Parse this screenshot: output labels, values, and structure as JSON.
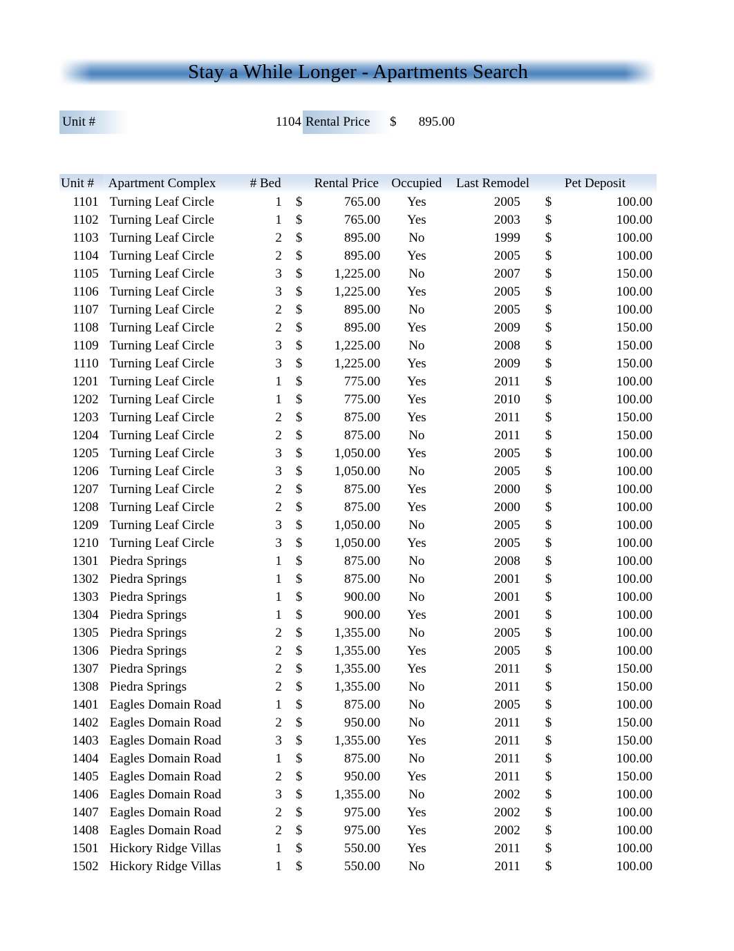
{
  "document": {
    "title": "Stay a While Longer - Apartments Search"
  },
  "lookup": {
    "unit_label": "Unit #",
    "unit_value": "1104",
    "price_label": "Rental Price",
    "price_symbol": "$",
    "price_value": "895.00"
  },
  "table": {
    "headers": {
      "unit": "Unit #",
      "complex": "Apartment Complex",
      "bed": "# Bed",
      "price": "Rental Price",
      "occupied": "Occupied",
      "remodel": "Last Remodel",
      "deposit": "Pet Deposit"
    },
    "currency_symbol": "$",
    "rows": [
      {
        "unit": "1101",
        "complex": "Turning Leaf Circle",
        "bed": "1",
        "sym": "$",
        "price": "765.00",
        "occupied": "Yes",
        "remodel": "2005",
        "dsym": "$",
        "deposit": "100.00"
      },
      {
        "unit": "1102",
        "complex": "Turning Leaf Circle",
        "bed": "1",
        "sym": "$",
        "price": "765.00",
        "occupied": "Yes",
        "remodel": "2003",
        "dsym": "$",
        "deposit": "100.00"
      },
      {
        "unit": "1103",
        "complex": "Turning Leaf Circle",
        "bed": "2",
        "sym": "$",
        "price": "895.00",
        "occupied": "No",
        "remodel": "1999",
        "dsym": "$",
        "deposit": "100.00"
      },
      {
        "unit": "1104",
        "complex": "Turning Leaf Circle",
        "bed": "2",
        "sym": "$",
        "price": "895.00",
        "occupied": "Yes",
        "remodel": "2005",
        "dsym": "$",
        "deposit": "100.00"
      },
      {
        "unit": "1105",
        "complex": "Turning Leaf Circle",
        "bed": "3",
        "sym": "$",
        "price": "1,225.00",
        "occupied": "No",
        "remodel": "2007",
        "dsym": "$",
        "deposit": "150.00"
      },
      {
        "unit": "1106",
        "complex": "Turning Leaf Circle",
        "bed": "3",
        "sym": "$",
        "price": "1,225.00",
        "occupied": "Yes",
        "remodel": "2005",
        "dsym": "$",
        "deposit": "100.00"
      },
      {
        "unit": "1107",
        "complex": "Turning Leaf Circle",
        "bed": "2",
        "sym": "$",
        "price": "895.00",
        "occupied": "No",
        "remodel": "2005",
        "dsym": "$",
        "deposit": "100.00"
      },
      {
        "unit": "1108",
        "complex": "Turning Leaf Circle",
        "bed": "2",
        "sym": "$",
        "price": "895.00",
        "occupied": "Yes",
        "remodel": "2009",
        "dsym": "$",
        "deposit": "150.00"
      },
      {
        "unit": "1109",
        "complex": "Turning Leaf Circle",
        "bed": "3",
        "sym": "$",
        "price": "1,225.00",
        "occupied": "No",
        "remodel": "2008",
        "dsym": "$",
        "deposit": "150.00"
      },
      {
        "unit": "1110",
        "complex": "Turning Leaf Circle",
        "bed": "3",
        "sym": "$",
        "price": "1,225.00",
        "occupied": "Yes",
        "remodel": "2009",
        "dsym": "$",
        "deposit": "150.00"
      },
      {
        "unit": "1201",
        "complex": "Turning Leaf Circle",
        "bed": "1",
        "sym": "$",
        "price": "775.00",
        "occupied": "Yes",
        "remodel": "2011",
        "dsym": "$",
        "deposit": "100.00"
      },
      {
        "unit": "1202",
        "complex": "Turning Leaf Circle",
        "bed": "1",
        "sym": "$",
        "price": "775.00",
        "occupied": "Yes",
        "remodel": "2010",
        "dsym": "$",
        "deposit": "100.00"
      },
      {
        "unit": "1203",
        "complex": "Turning Leaf Circle",
        "bed": "2",
        "sym": "$",
        "price": "875.00",
        "occupied": "Yes",
        "remodel": "2011",
        "dsym": "$",
        "deposit": "150.00"
      },
      {
        "unit": "1204",
        "complex": "Turning Leaf Circle",
        "bed": "2",
        "sym": "$",
        "price": "875.00",
        "occupied": "No",
        "remodel": "2011",
        "dsym": "$",
        "deposit": "150.00"
      },
      {
        "unit": "1205",
        "complex": "Turning Leaf Circle",
        "bed": "3",
        "sym": "$",
        "price": "1,050.00",
        "occupied": "Yes",
        "remodel": "2005",
        "dsym": "$",
        "deposit": "100.00"
      },
      {
        "unit": "1206",
        "complex": "Turning Leaf Circle",
        "bed": "3",
        "sym": "$",
        "price": "1,050.00",
        "occupied": "No",
        "remodel": "2005",
        "dsym": "$",
        "deposit": "100.00"
      },
      {
        "unit": "1207",
        "complex": "Turning Leaf Circle",
        "bed": "2",
        "sym": "$",
        "price": "875.00",
        "occupied": "Yes",
        "remodel": "2000",
        "dsym": "$",
        "deposit": "100.00"
      },
      {
        "unit": "1208",
        "complex": "Turning Leaf Circle",
        "bed": "2",
        "sym": "$",
        "price": "875.00",
        "occupied": "Yes",
        "remodel": "2000",
        "dsym": "$",
        "deposit": "100.00"
      },
      {
        "unit": "1209",
        "complex": "Turning Leaf Circle",
        "bed": "3",
        "sym": "$",
        "price": "1,050.00",
        "occupied": "No",
        "remodel": "2005",
        "dsym": "$",
        "deposit": "100.00"
      },
      {
        "unit": "1210",
        "complex": "Turning Leaf Circle",
        "bed": "3",
        "sym": "$",
        "price": "1,050.00",
        "occupied": "Yes",
        "remodel": "2005",
        "dsym": "$",
        "deposit": "100.00"
      },
      {
        "unit": "1301",
        "complex": "Piedra Springs",
        "bed": "1",
        "sym": "$",
        "price": "875.00",
        "occupied": "No",
        "remodel": "2008",
        "dsym": "$",
        "deposit": "100.00"
      },
      {
        "unit": "1302",
        "complex": "Piedra Springs",
        "bed": "1",
        "sym": "$",
        "price": "875.00",
        "occupied": "No",
        "remodel": "2001",
        "dsym": "$",
        "deposit": "100.00"
      },
      {
        "unit": "1303",
        "complex": "Piedra Springs",
        "bed": "1",
        "sym": "$",
        "price": "900.00",
        "occupied": "No",
        "remodel": "2001",
        "dsym": "$",
        "deposit": "100.00"
      },
      {
        "unit": "1304",
        "complex": "Piedra Springs",
        "bed": "1",
        "sym": "$",
        "price": "900.00",
        "occupied": "Yes",
        "remodel": "2001",
        "dsym": "$",
        "deposit": "100.00"
      },
      {
        "unit": "1305",
        "complex": "Piedra Springs",
        "bed": "2",
        "sym": "$",
        "price": "1,355.00",
        "occupied": "No",
        "remodel": "2005",
        "dsym": "$",
        "deposit": "100.00"
      },
      {
        "unit": "1306",
        "complex": "Piedra Springs",
        "bed": "2",
        "sym": "$",
        "price": "1,355.00",
        "occupied": "Yes",
        "remodel": "2005",
        "dsym": "$",
        "deposit": "100.00"
      },
      {
        "unit": "1307",
        "complex": "Piedra Springs",
        "bed": "2",
        "sym": "$",
        "price": "1,355.00",
        "occupied": "Yes",
        "remodel": "2011",
        "dsym": "$",
        "deposit": "150.00"
      },
      {
        "unit": "1308",
        "complex": "Piedra Springs",
        "bed": "2",
        "sym": "$",
        "price": "1,355.00",
        "occupied": "No",
        "remodel": "2011",
        "dsym": "$",
        "deposit": "150.00"
      },
      {
        "unit": "1401",
        "complex": "Eagles Domain Road",
        "bed": "1",
        "sym": "$",
        "price": "875.00",
        "occupied": "No",
        "remodel": "2005",
        "dsym": "$",
        "deposit": "100.00"
      },
      {
        "unit": "1402",
        "complex": "Eagles Domain Road",
        "bed": "2",
        "sym": "$",
        "price": "950.00",
        "occupied": "No",
        "remodel": "2011",
        "dsym": "$",
        "deposit": "150.00"
      },
      {
        "unit": "1403",
        "complex": "Eagles Domain Road",
        "bed": "3",
        "sym": "$",
        "price": "1,355.00",
        "occupied": "Yes",
        "remodel": "2011",
        "dsym": "$",
        "deposit": "150.00"
      },
      {
        "unit": "1404",
        "complex": "Eagles Domain Road",
        "bed": "1",
        "sym": "$",
        "price": "875.00",
        "occupied": "No",
        "remodel": "2011",
        "dsym": "$",
        "deposit": "100.00"
      },
      {
        "unit": "1405",
        "complex": "Eagles Domain Road",
        "bed": "2",
        "sym": "$",
        "price": "950.00",
        "occupied": "Yes",
        "remodel": "2011",
        "dsym": "$",
        "deposit": "150.00"
      },
      {
        "unit": "1406",
        "complex": "Eagles Domain Road",
        "bed": "3",
        "sym": "$",
        "price": "1,355.00",
        "occupied": "No",
        "remodel": "2002",
        "dsym": "$",
        "deposit": "100.00"
      },
      {
        "unit": "1407",
        "complex": "Eagles Domain Road",
        "bed": "2",
        "sym": "$",
        "price": "975.00",
        "occupied": "Yes",
        "remodel": "2002",
        "dsym": "$",
        "deposit": "100.00"
      },
      {
        "unit": "1408",
        "complex": "Eagles Domain Road",
        "bed": "2",
        "sym": "$",
        "price": "975.00",
        "occupied": "Yes",
        "remodel": "2002",
        "dsym": "$",
        "deposit": "100.00"
      },
      {
        "unit": "1501",
        "complex": "Hickory Ridge Villas",
        "bed": "1",
        "sym": "$",
        "price": "550.00",
        "occupied": "Yes",
        "remodel": "2011",
        "dsym": "$",
        "deposit": "100.00"
      },
      {
        "unit": "1502",
        "complex": "Hickory Ridge Villas",
        "bed": "1",
        "sym": "$",
        "price": "550.00",
        "occupied": "No",
        "remodel": "2011",
        "dsym": "$",
        "deposit": "100.00"
      }
    ]
  },
  "colors": {
    "banner_blue": "#4e83bd",
    "header_blue": "#d3e0ef",
    "label_blue": "#b3cae2",
    "text": "#000000",
    "page_background": "#ffffff"
  }
}
